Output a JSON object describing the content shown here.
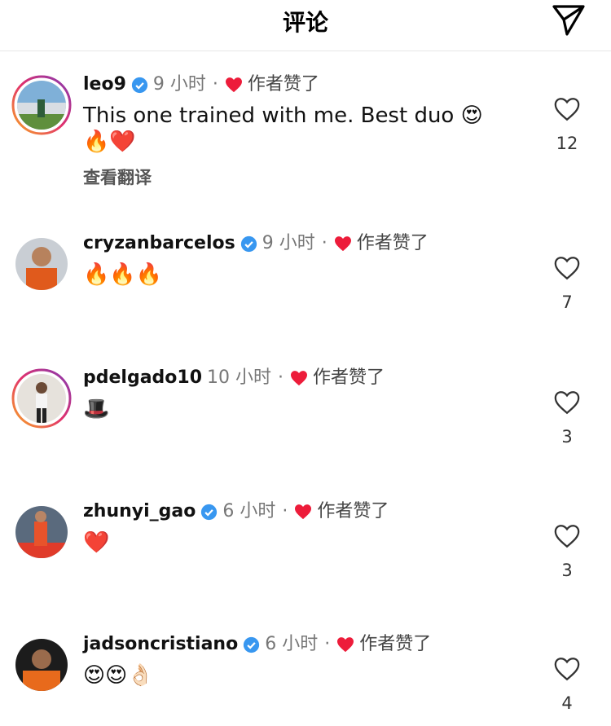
{
  "header": {
    "title": "评论"
  },
  "comments": [
    {
      "username": "leo9",
      "time": "9 小时",
      "liked_label": "作者赞了",
      "text": "This one trained with me. Best duo 😍🔥❤️",
      "translate": "查看翻译",
      "likes": "12",
      "verified": true
    },
    {
      "username": "cryzanbarcelos",
      "time": "9 小时",
      "liked_label": "作者赞了",
      "text": "🔥🔥🔥",
      "likes": "7",
      "verified": true
    },
    {
      "username": "pdelgado10",
      "time": "10 小时",
      "liked_label": "作者赞了",
      "text": "🎩",
      "likes": "3",
      "verified": false
    },
    {
      "username": "zhunyi_gao",
      "time": "6 小时",
      "liked_label": "作者赞了",
      "text": "❤️",
      "likes": "3",
      "verified": true
    },
    {
      "username": "jadsoncristiano",
      "time": "6 小时",
      "liked_label": "作者赞了",
      "text": "😍😍👌🏻",
      "likes": "4",
      "verified": true
    }
  ],
  "colors": {
    "verified_blue": "#3897f0",
    "heart_red": "#ed1c3a",
    "story_ring": [
      "#f9a825",
      "#e1306c",
      "#833ab4"
    ]
  },
  "icons": {
    "send": "send-icon",
    "verified": "verified-badge-icon",
    "liked": "heart-filled-icon",
    "like": "heart-outline-icon"
  }
}
